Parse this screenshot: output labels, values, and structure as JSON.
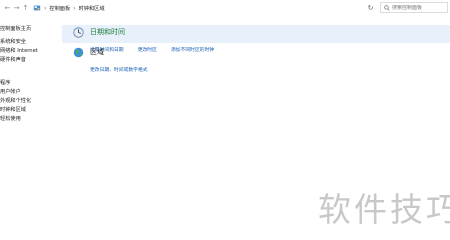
{
  "addressbar": {
    "back_symbol": "←",
    "forward_symbol": "→",
    "up_symbol": "↑",
    "breadcrumb": [
      "控制面板",
      "时钟和区域"
    ],
    "separator": "›",
    "refresh_symbol": "↻",
    "search_placeholder": "搜索控制面板"
  },
  "sidebar": {
    "items": [
      "控制面板主页",
      "系统和安全",
      "网络和 Internet",
      "硬件和声音",
      "程序",
      "用户帐户",
      "外观和个性化",
      "时钟和区域",
      "轻松使用"
    ]
  },
  "categories": [
    {
      "title": "日期和时间",
      "links": [
        "设置时间和日期",
        "更改时区",
        "添加不同时区的时钟"
      ]
    },
    {
      "title": "区域",
      "links": [
        "更改日期、时间或数字格式"
      ]
    }
  ],
  "watermark": "软件技巧",
  "colors": {
    "selected_row": "#e8f1fb",
    "category_title": "#197d3a",
    "link": "#1a5fb4"
  }
}
